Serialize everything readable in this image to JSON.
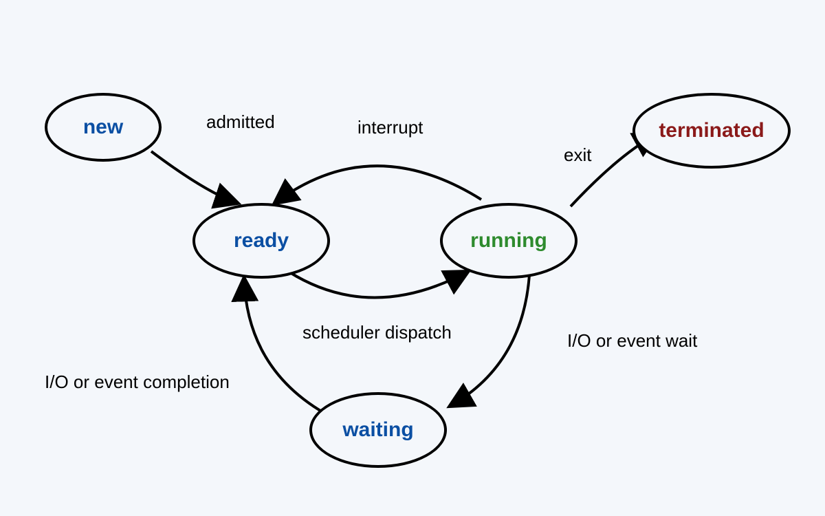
{
  "states": {
    "new": {
      "label": "new",
      "color": "#0b4fa3"
    },
    "ready": {
      "label": "ready",
      "color": "#0b4fa3"
    },
    "running": {
      "label": "running",
      "color": "#2e8b2e"
    },
    "waiting": {
      "label": "waiting",
      "color": "#0b4fa3"
    },
    "terminated": {
      "label": "terminated",
      "color": "#8b1a1a"
    }
  },
  "transitions": {
    "new_to_ready": {
      "label": "admitted",
      "from": "new",
      "to": "ready"
    },
    "running_to_ready": {
      "label": "interrupt",
      "from": "running",
      "to": "ready"
    },
    "ready_to_running": {
      "label": "scheduler dispatch",
      "from": "ready",
      "to": "running"
    },
    "running_to_terminated": {
      "label": "exit",
      "from": "running",
      "to": "terminated"
    },
    "running_to_waiting": {
      "label": "I/O or event wait",
      "from": "running",
      "to": "waiting"
    },
    "waiting_to_ready": {
      "label": "I/O or event completion",
      "from": "waiting",
      "to": "ready"
    }
  }
}
